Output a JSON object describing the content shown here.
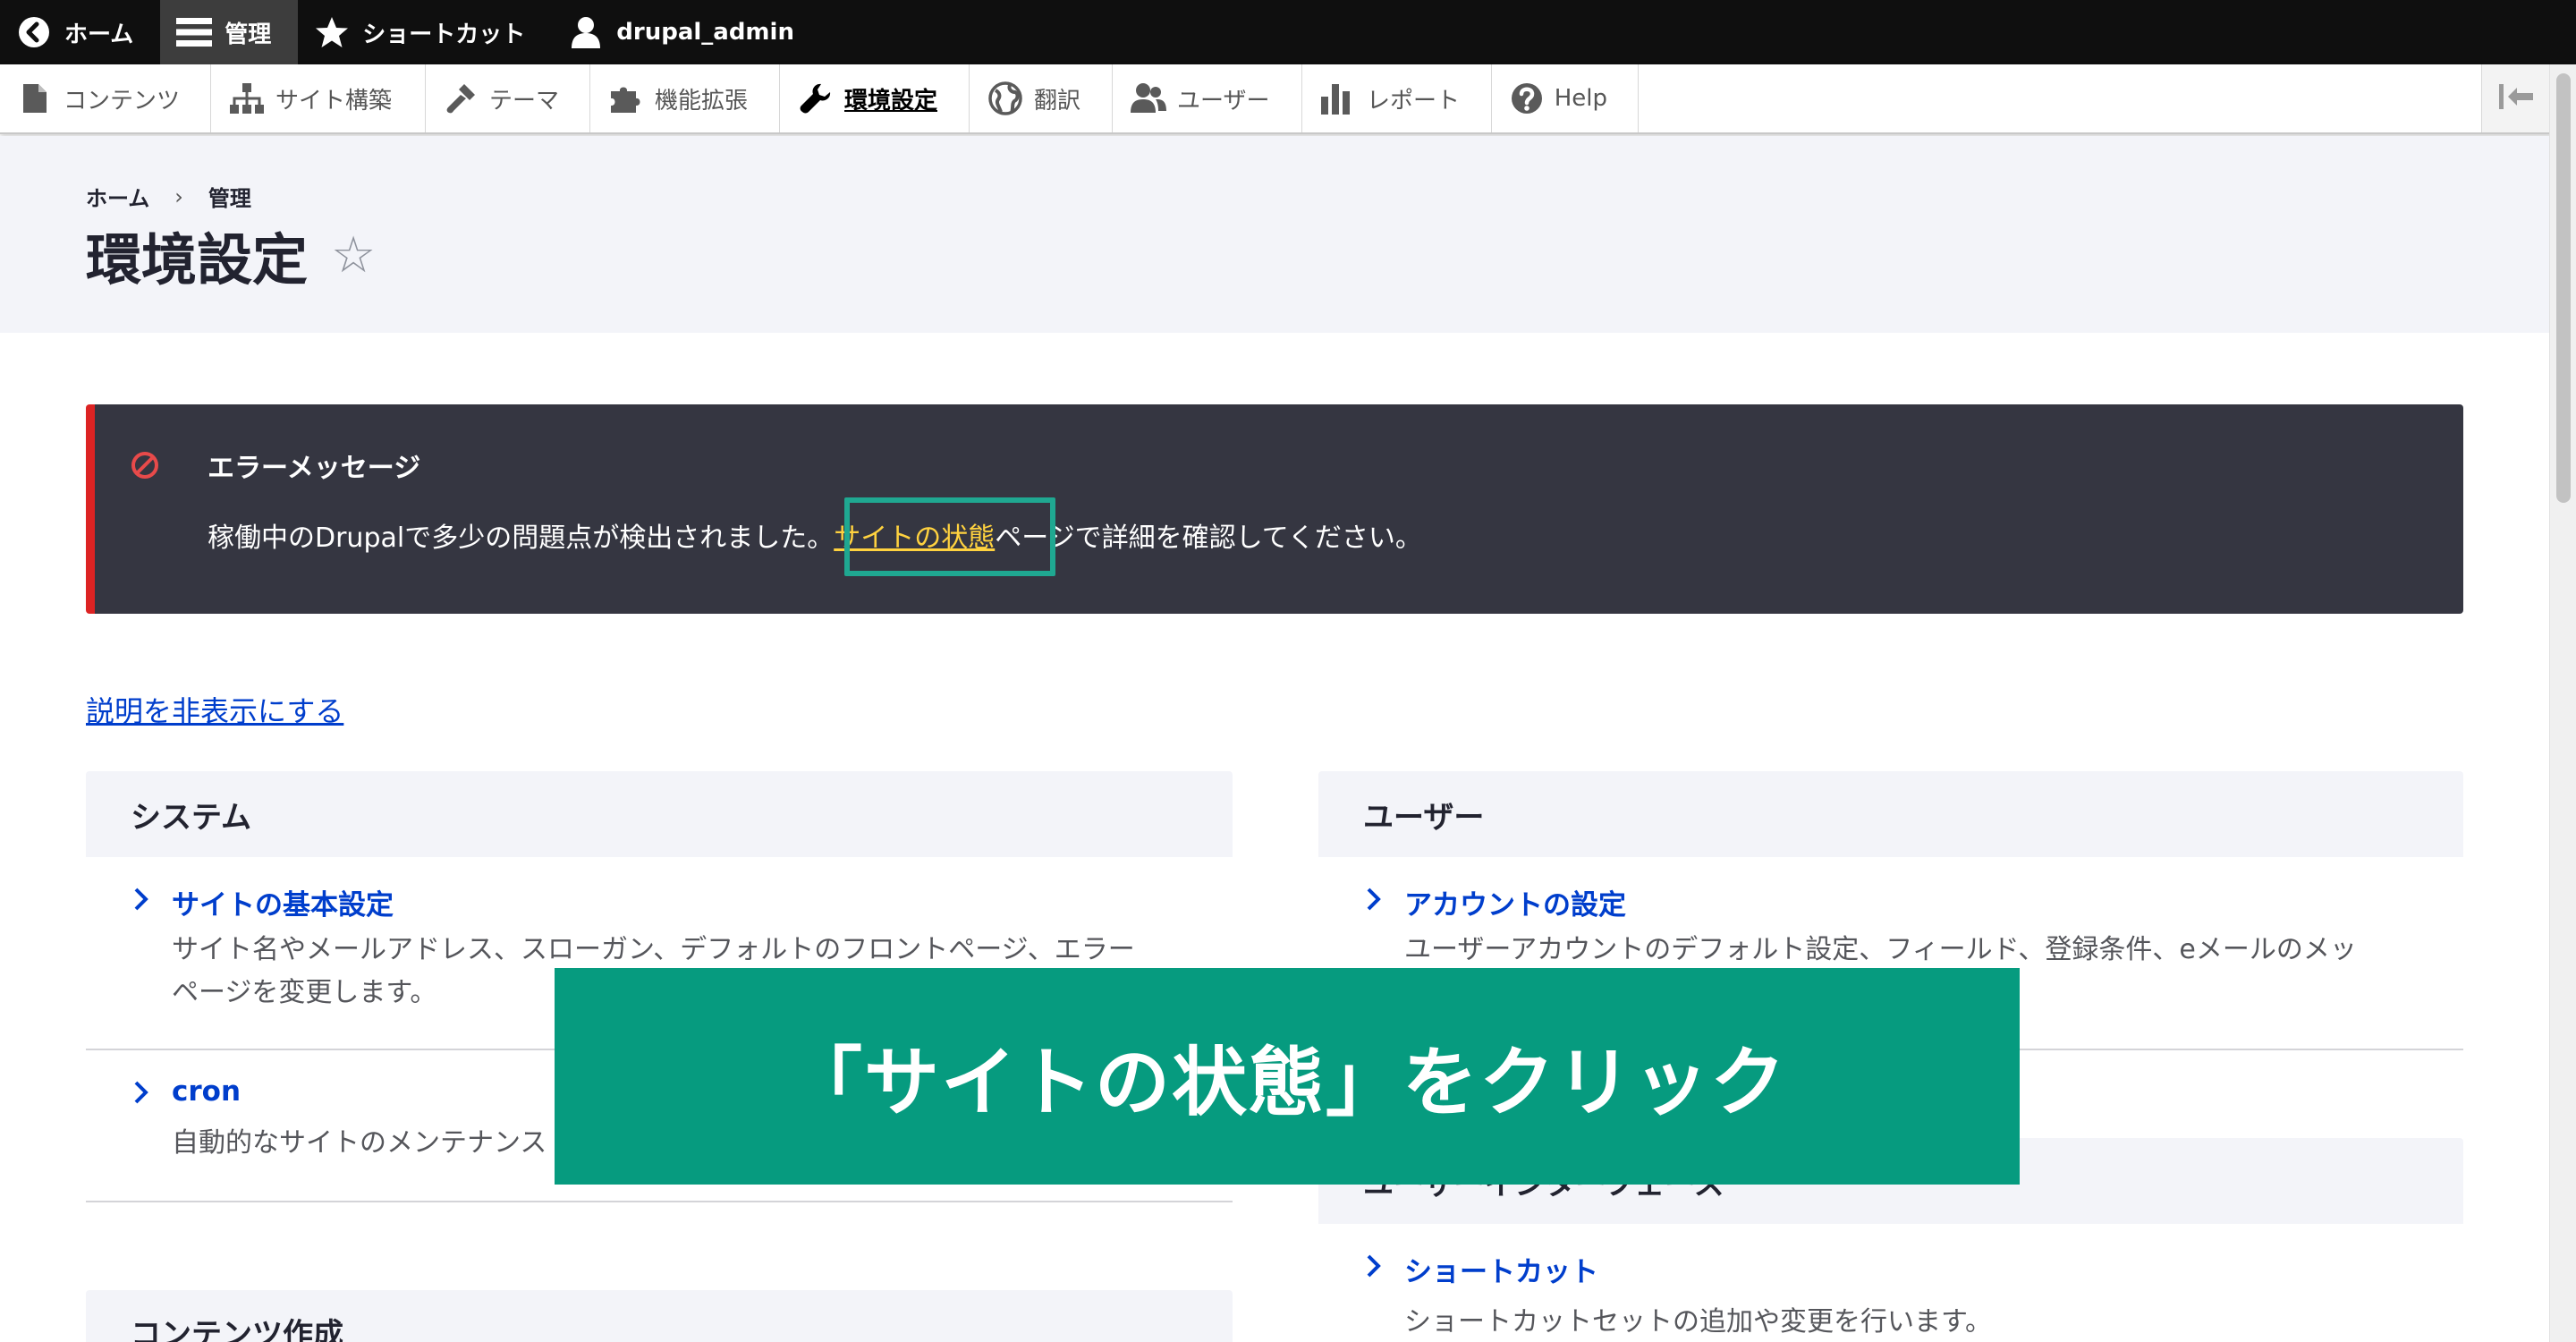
{
  "toolbar": {
    "home_label": "ホーム",
    "manage_label": "管理",
    "shortcuts_label": "ショートカット",
    "user_label": "drupal_admin"
  },
  "tray": {
    "items": [
      {
        "label": "コンテンツ",
        "icon": "document-icon"
      },
      {
        "label": "サイト構築",
        "icon": "structure-icon"
      },
      {
        "label": "テーマ",
        "icon": "paintbrush-icon"
      },
      {
        "label": "機能拡張",
        "icon": "puzzle-icon"
      },
      {
        "label": "環境設定",
        "icon": "wrench-icon"
      },
      {
        "label": "翻訳",
        "icon": "globe-icon"
      },
      {
        "label": "ユーザー",
        "icon": "people-icon"
      },
      {
        "label": "レポート",
        "icon": "bar-chart-icon"
      },
      {
        "label": "Help",
        "icon": "help-icon"
      }
    ]
  },
  "breadcrumb": {
    "home": "ホーム",
    "separator": "›",
    "manage": "管理"
  },
  "page": {
    "title": "環境設定",
    "star": "☆"
  },
  "error": {
    "title": "エラーメッセージ",
    "text_before": "稼働中のDrupalで多少の問題点が検出されました。",
    "link": "サイトの状態",
    "text_after": "ページで詳細を確認してください。"
  },
  "hide_descriptions": "説明を非表示にする",
  "panels": {
    "system": {
      "title": "システム",
      "items": [
        {
          "link": "サイトの基本設定",
          "desc_line1": "サイト名やメールアドレス、スローガン、デフォルトのフロントページ、エラー",
          "desc_line2": "ページを変更します。"
        },
        {
          "link": "cron",
          "desc_line1": "自動的なサイトのメンテナンス"
        }
      ]
    },
    "content_authoring": {
      "title": "コンテンツ作成"
    },
    "people": {
      "title": "ユーザー",
      "items": [
        {
          "link": "アカウントの設定",
          "desc_line1": "ユーザーアカウントのデフォルト設定、フィールド、登録条件、eメールのメッ"
        }
      ]
    },
    "user_interface": {
      "title": "ユーザーインターフェース",
      "items": [
        {
          "link": "ショートカット",
          "desc_line1": "ショートカットセットの追加や変更を行います。"
        }
      ]
    }
  },
  "caption": "「サイトの状態」をクリック",
  "colors": {
    "toolbar_bg": "#0f0f0f",
    "error_bg": "#353641",
    "error_border": "#dc2323",
    "link_yellow": "#ffd23f",
    "highlight": "#1fa891",
    "caption_bg": "#069b7f",
    "link_blue": "#003ecc"
  }
}
